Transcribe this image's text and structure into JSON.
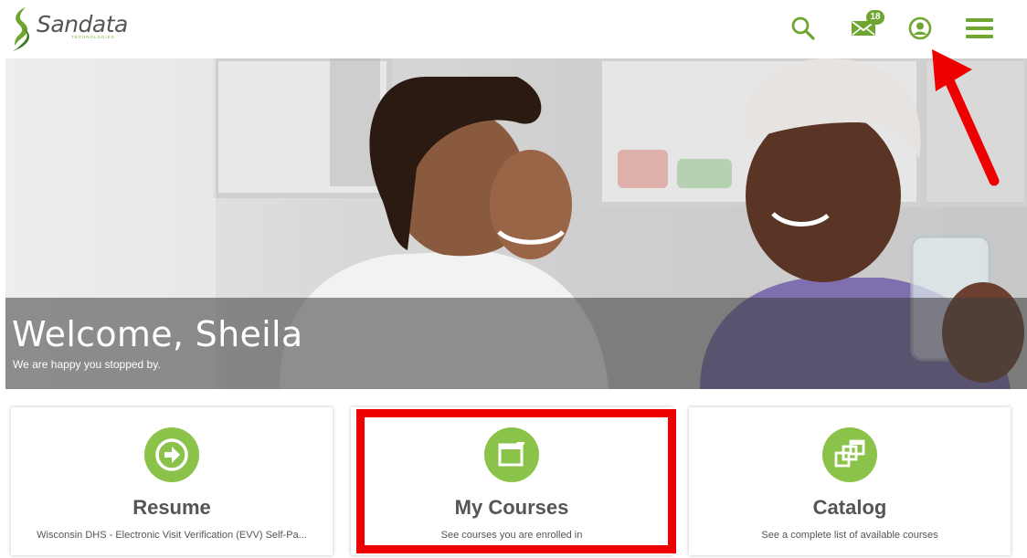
{
  "header": {
    "brand_name": "Sandata",
    "brand_subtitle": "TECHNOLOGIES",
    "icons": {
      "search": "search-icon",
      "mail": "mail-icon",
      "profile": "profile-icon",
      "menu": "hamburger-menu-icon"
    },
    "mail_badge": "18"
  },
  "hero": {
    "welcome": "Welcome, Sheila",
    "subtitle": "We are happy you stopped by."
  },
  "cards": [
    {
      "title": "Resume",
      "description": "Wisconsin DHS - Electronic Visit Verification (EVV) Self-Pa...",
      "icon": "arrow-circle-right-icon"
    },
    {
      "title": "My Courses",
      "description": "See courses you are enrolled in",
      "icon": "courses-icon"
    },
    {
      "title": "Catalog",
      "description": "See a complete list of available courses",
      "icon": "catalog-icon"
    }
  ],
  "colors": {
    "brand_green": "#6fa631",
    "icon_circle": "#8bc34a",
    "annotation_red": "#ee0000"
  }
}
